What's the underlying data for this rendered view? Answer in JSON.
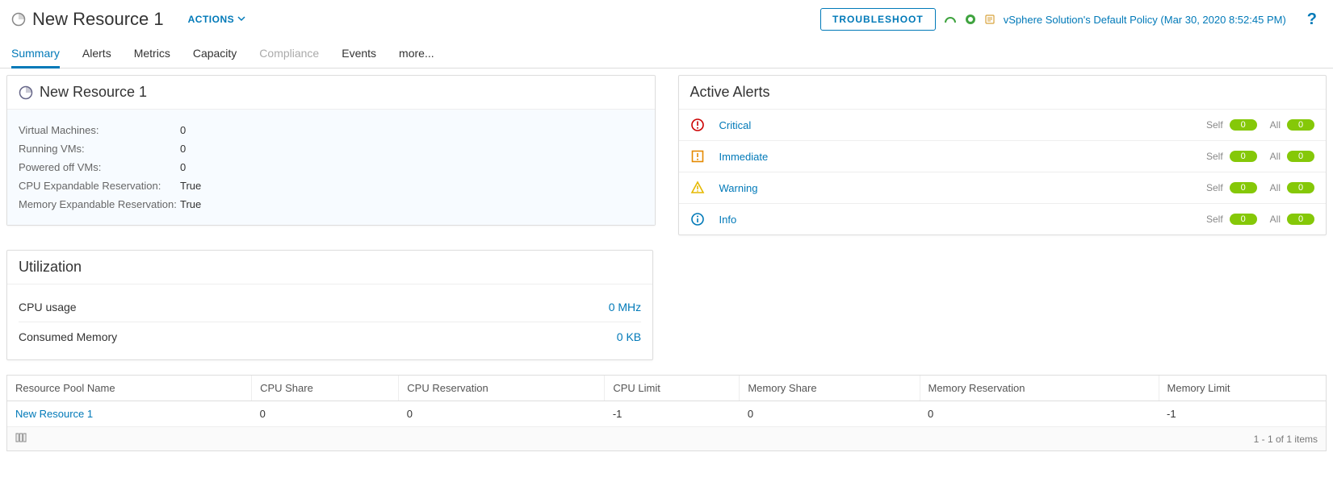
{
  "header": {
    "title": "New Resource 1",
    "actions_label": "ACTIONS",
    "troubleshoot_label": "TROUBLESHOOT",
    "policy_text": "vSphere Solution's Default Policy (Mar 30, 2020 8:52:45 PM)"
  },
  "tabs": [
    {
      "label": "Summary",
      "state": "active"
    },
    {
      "label": "Alerts",
      "state": ""
    },
    {
      "label": "Metrics",
      "state": ""
    },
    {
      "label": "Capacity",
      "state": ""
    },
    {
      "label": "Compliance",
      "state": "disabled"
    },
    {
      "label": "Events",
      "state": ""
    },
    {
      "label": "more...",
      "state": ""
    }
  ],
  "resource_panel": {
    "title": "New Resource 1",
    "rows": [
      {
        "label": "Virtual Machines:",
        "value": "0"
      },
      {
        "label": "Running VMs:",
        "value": "0"
      },
      {
        "label": "Powered off VMs:",
        "value": "0"
      },
      {
        "label": "CPU Expandable Reservation:",
        "value": "True"
      },
      {
        "label": "Memory Expandable Reservation:",
        "value": "True"
      }
    ]
  },
  "alerts_panel": {
    "title": "Active Alerts",
    "self_label": "Self",
    "all_label": "All",
    "rows": [
      {
        "name": "Critical",
        "icon": "critical",
        "self": "0",
        "all": "0"
      },
      {
        "name": "Immediate",
        "icon": "immediate",
        "self": "0",
        "all": "0"
      },
      {
        "name": "Warning",
        "icon": "warning",
        "self": "0",
        "all": "0"
      },
      {
        "name": "Info",
        "icon": "info",
        "self": "0",
        "all": "0"
      }
    ]
  },
  "utilization_panel": {
    "title": "Utilization",
    "rows": [
      {
        "label": "CPU usage",
        "value": "0 MHz"
      },
      {
        "label": "Consumed Memory",
        "value": "0 KB"
      }
    ]
  },
  "table": {
    "columns": [
      "Resource Pool Name",
      "CPU Share",
      "CPU Reservation",
      "CPU Limit",
      "Memory Share",
      "Memory Reservation",
      "Memory Limit"
    ],
    "rows": [
      {
        "name": "New Resource 1",
        "cpu_share": "0",
        "cpu_res": "0",
        "cpu_limit": "-1",
        "mem_share": "0",
        "mem_res": "0",
        "mem_limit": "-1"
      }
    ],
    "footer": "1 - 1 of 1 items"
  }
}
